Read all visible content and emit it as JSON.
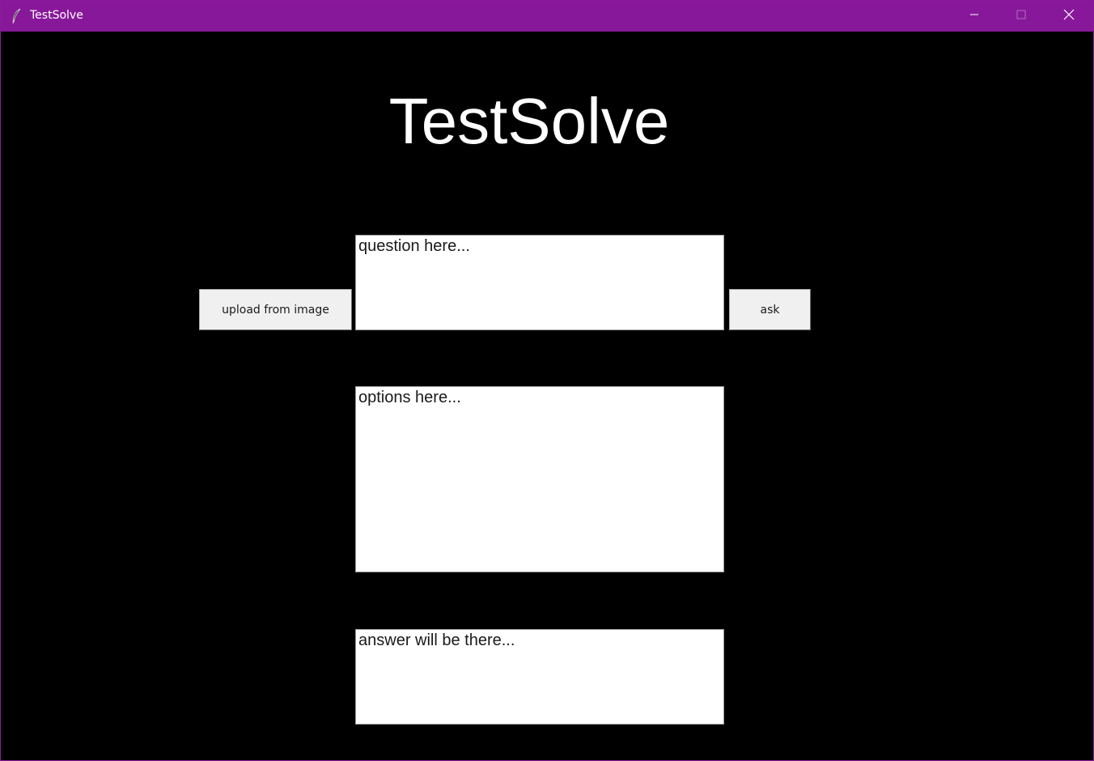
{
  "window": {
    "title": "TestSolve",
    "titlebar_color": "#88189a",
    "controls": [
      "minimize-icon",
      "maximize-icon",
      "close-icon"
    ]
  },
  "app": {
    "heading": "TestSolve",
    "background_color": "#000000",
    "question_box": {
      "text": "question here..."
    },
    "options_box": {
      "text": "options here..."
    },
    "answer_box": {
      "text": "answer will be there..."
    },
    "buttons": {
      "upload_label": "upload from image",
      "ask_label": "ask"
    }
  }
}
